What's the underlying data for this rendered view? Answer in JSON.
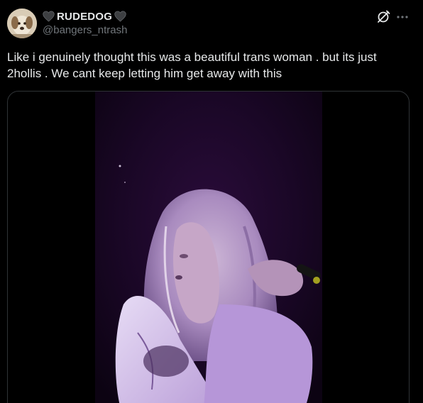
{
  "author": {
    "display_name": "RUDEDOG",
    "handle": "@bangers_ntrash",
    "name_decorations": [
      "black-heart-icon",
      "black-heart-icon"
    ]
  },
  "actions": {
    "grok_icon": "grok-icon",
    "more_icon": "more-icon"
  },
  "tweet": {
    "text": "Like i genuinely thought this was a beautiful trans woman . but its just 2hollis . We cant keep letting him get away with this"
  },
  "media": {
    "type": "video",
    "description_icon": "video-frame"
  },
  "colors": {
    "background": "#000000",
    "text_primary": "#e7e9ea",
    "text_secondary": "#71767b",
    "border": "#2f3336"
  }
}
